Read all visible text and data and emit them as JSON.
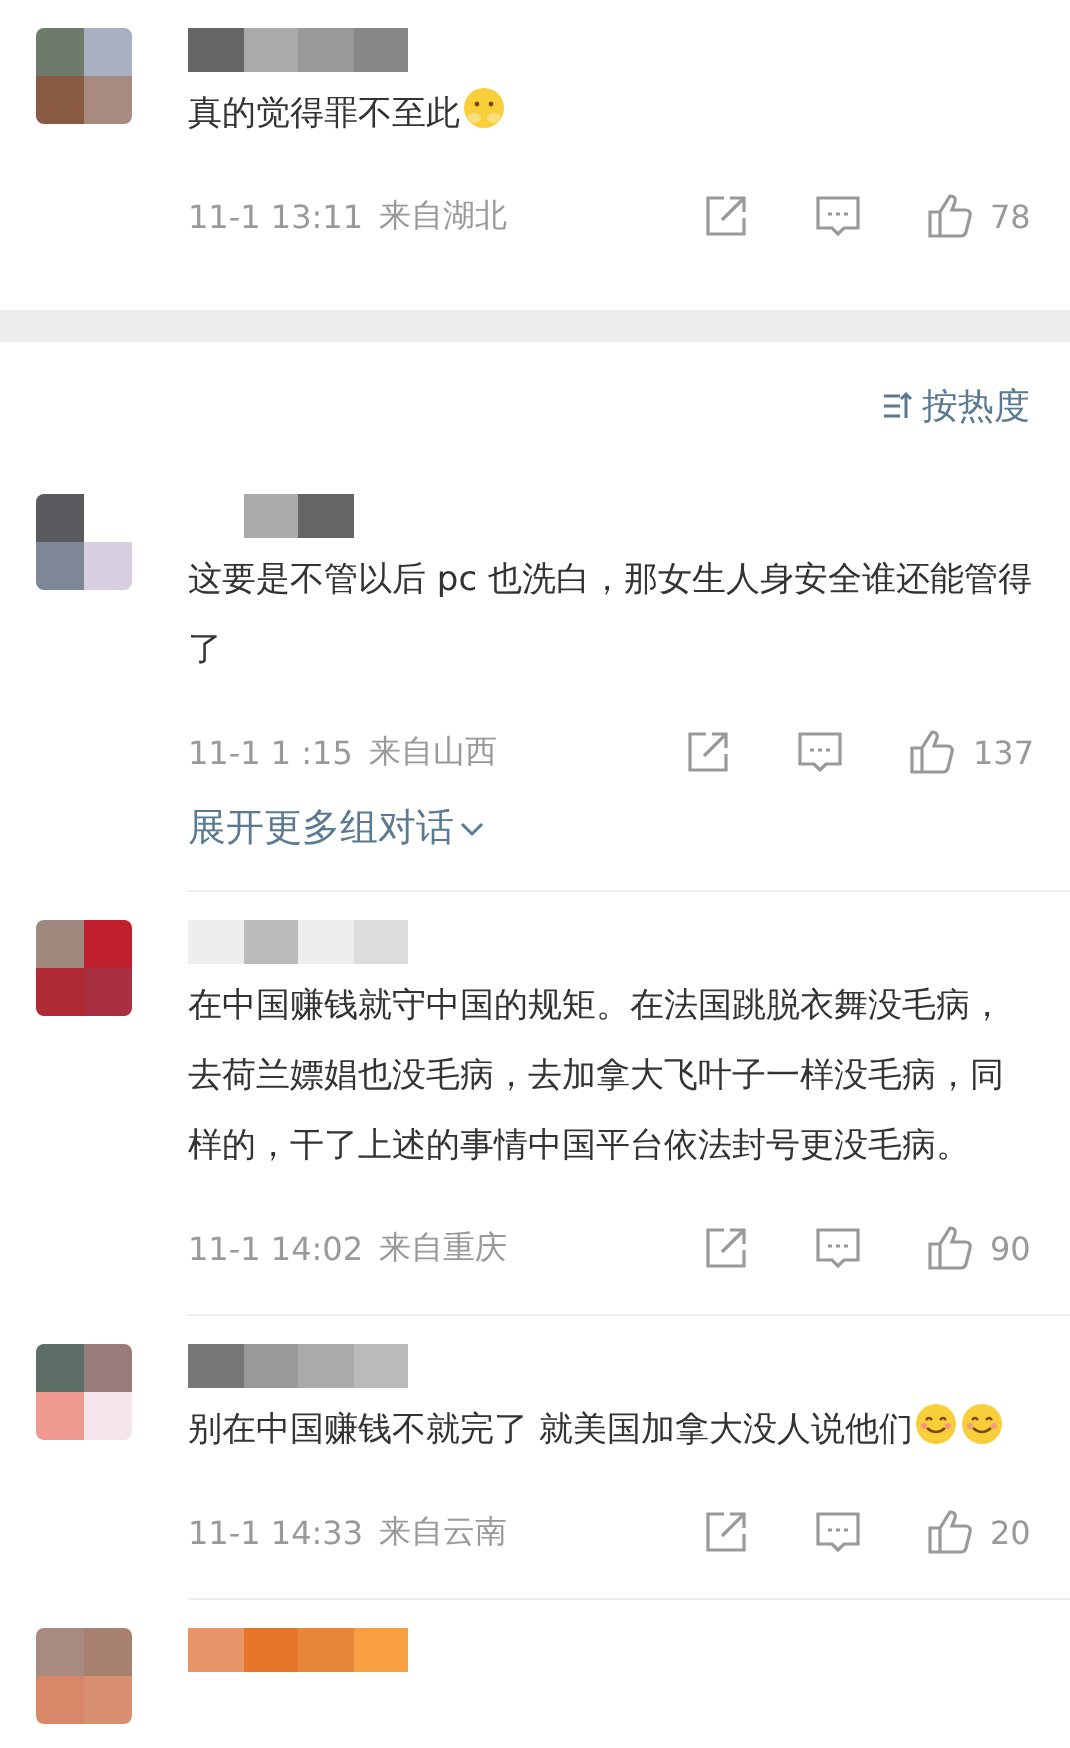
{
  "comments": [
    {
      "text": "真的觉得罪不至此",
      "emojis": [
        {
          "kind": "worried"
        }
      ],
      "time": "11-1 13:11",
      "location": "来自湖北",
      "likes": "78"
    },
    {
      "kind": "sort",
      "label": "按热度"
    },
    {
      "text": "这要是不管以后 pc 也洗白，那女生人身安全谁还能管得了",
      "time": "11-1 1  :15",
      "location": "来自山西",
      "likes": "137",
      "expand": "展开更多组对话"
    },
    {
      "text": "在中国赚钱就守中国的规矩。在法国跳脱衣舞没毛病，去荷兰嫖娼也没毛病，去加拿大飞叶子一样没毛病，同样的，干了上述的事情中国平台依法封号更没毛病。",
      "time": "11-1 14:02",
      "location": "来自重庆",
      "likes": "90"
    },
    {
      "text": "别在中国赚钱不就完了 就美国加拿大没人说他们",
      "emojis": [
        {
          "kind": "smile"
        },
        {
          "kind": "smile"
        }
      ],
      "time": "11-1 14:33",
      "location": "来自云南",
      "likes": "20"
    },
    {
      "kind": "stub"
    }
  ]
}
